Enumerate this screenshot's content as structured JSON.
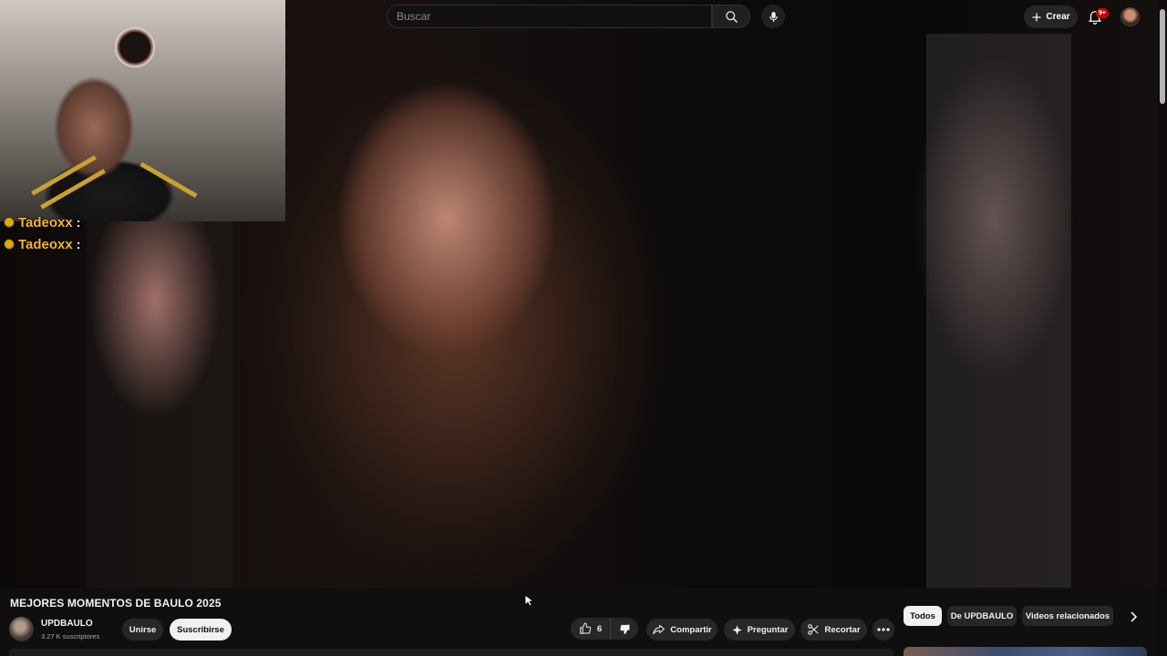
{
  "search": {
    "placeholder": "Buscar"
  },
  "header": {
    "create_label": "Crear",
    "notifications_badge": "9+"
  },
  "stream_overlay": {
    "chat": [
      {
        "user": "Tadeoxx",
        "separator": ":"
      },
      {
        "user": "Tadeoxx",
        "separator": ":"
      }
    ]
  },
  "video": {
    "title": "MEJORES MOMENTOS DE BAULO 2025",
    "channel_name": "UPDBAULO",
    "subscribers": "3.27 K suscriptores",
    "join_label": "Unirse",
    "subscribe_label": "Suscribirse",
    "likes": "6",
    "share_label": "Compartir",
    "ask_label": "Preguntar",
    "clip_label": "Recortar"
  },
  "related_chips": [
    "Todos",
    "De UPDBAULO",
    "Videos relacionados"
  ],
  "icons": {
    "search": "search-icon",
    "mic": "microphone-icon",
    "create": "plus-icon",
    "bell": "bell-icon",
    "like": "thumbs-up-icon",
    "dislike": "thumbs-down-icon",
    "share": "share-arrow-icon",
    "ask": "sparkle-icon",
    "clip": "scissors-icon",
    "more": "more-horizontal-icon",
    "next": "chevron-right-icon"
  },
  "colors": {
    "background": "#0f0f0f",
    "button_dark": "#272727",
    "button_light": "#f1f1f1",
    "notification_red": "#cc0000",
    "chat_username": "#f5b52e"
  }
}
